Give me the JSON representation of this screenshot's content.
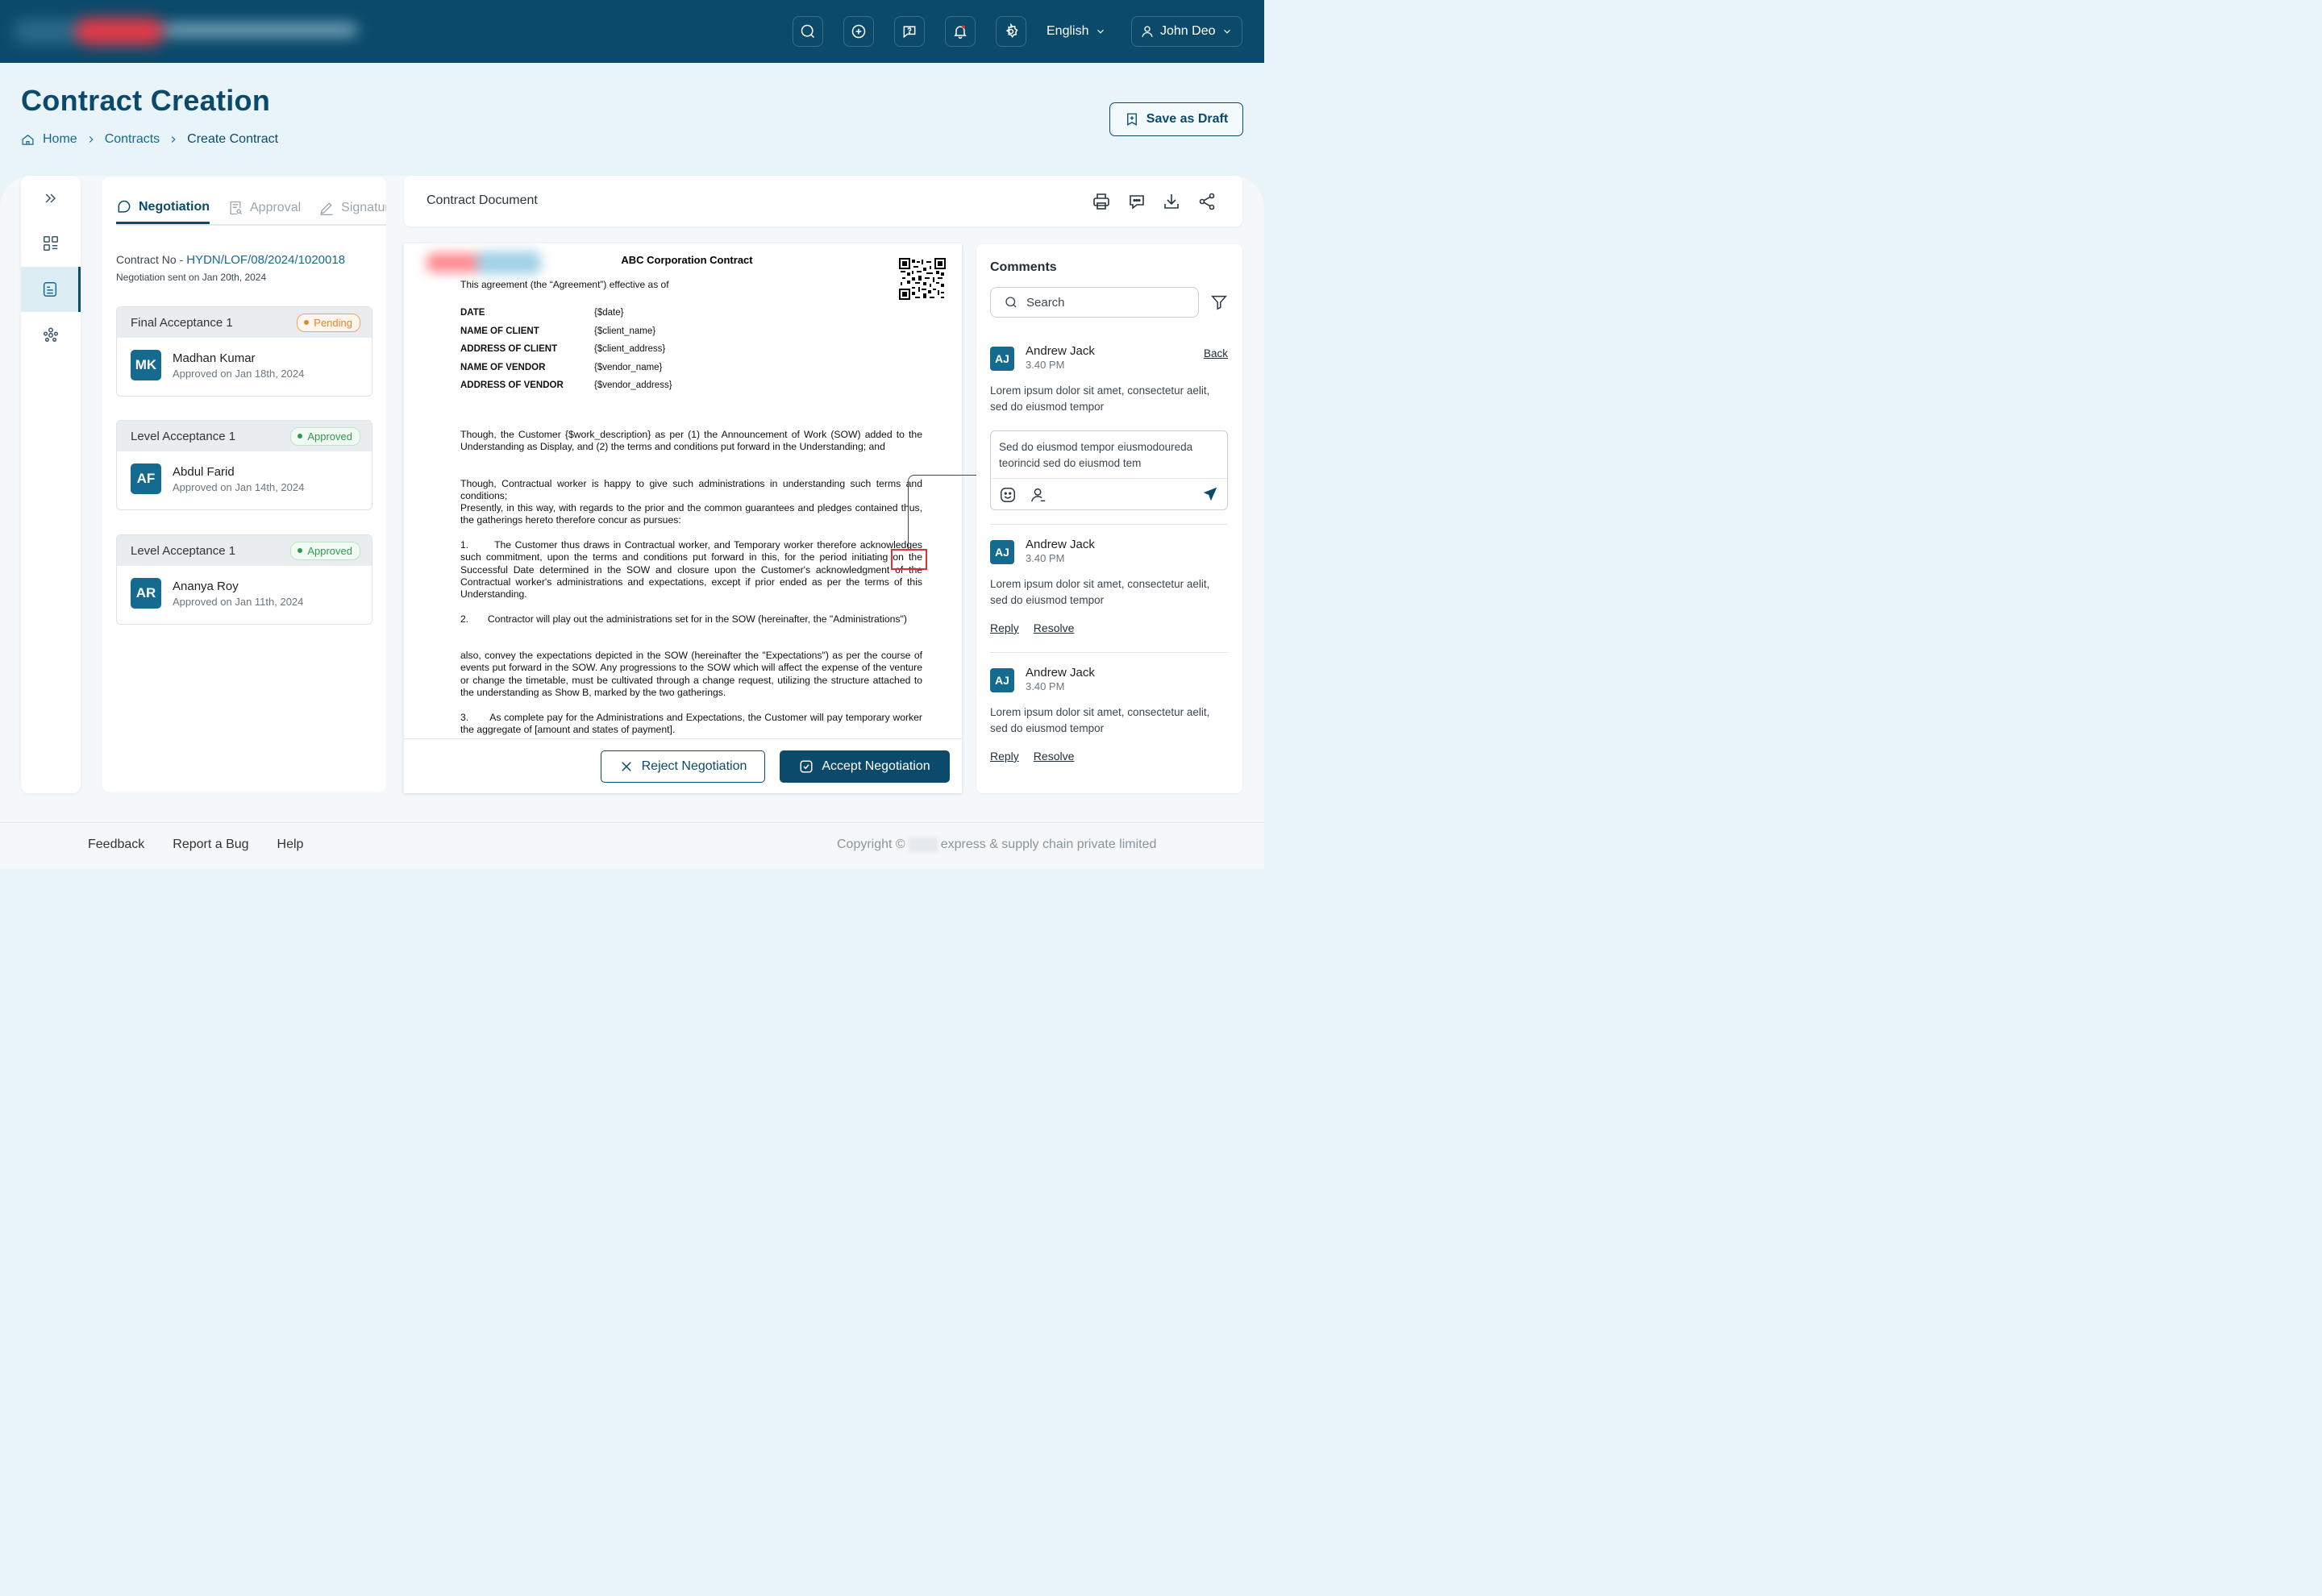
{
  "header": {
    "language": "English",
    "user_name": "John Deo",
    "icons": [
      "search-icon",
      "plus-circle-icon",
      "chat-question-icon",
      "bell-icon",
      "gear-icon"
    ]
  },
  "page": {
    "title": "Contract Creation",
    "breadcrumb": [
      "Home",
      "Contracts",
      "Create Contract"
    ],
    "save_draft": "Save as Draft"
  },
  "workflow": {
    "tabs": [
      "Negotiation",
      "Approval",
      "Signature"
    ],
    "contract_no_label": "Contract No -",
    "contract_no": "HYDN/LOF/08/2024/1020018",
    "sent_note": "Negotiation sent on Jan 20th, 2024",
    "acceptances": [
      {
        "title": "Final Acceptance 1",
        "status": "Pending",
        "initials": "MK",
        "name": "Madhan Kumar",
        "date": "Approved on Jan 18th, 2024"
      },
      {
        "title": "Level Acceptance 1",
        "status": "Approved",
        "initials": "AF",
        "name": "Abdul Farid",
        "date": "Approved on Jan 14th, 2024"
      },
      {
        "title": "Level Acceptance 1",
        "status": "Approved",
        "initials": "AR",
        "name": "Ananya Roy",
        "date": "Approved on Jan 11th, 2024"
      }
    ]
  },
  "document": {
    "panel_title": "Contract Document",
    "heading": "ABC Corporation Contract",
    "intro": "This agreement (the “Agreement”) effective as of",
    "fields": [
      {
        "key": "DATE",
        "value": "{$date}"
      },
      {
        "key": "NAME OF CLIENT",
        "value": "{$client_name}"
      },
      {
        "key": "ADDRESS OF CLIENT",
        "value": "{$client_address}"
      },
      {
        "key": "NAME OF VENDOR",
        "value": "{$vendor_name}"
      },
      {
        "key": "ADDRESS OF VENDOR",
        "value": "{$vendor_address}"
      }
    ],
    "para1": "Though, the Customer {$work_description} as per (1) the Announcement of Work (SOW) added to the Understanding as Display, and (2) the terms and conditions put forward in the Understanding; and",
    "para2": "Though, Contractual worker is happy to give such administrations in understanding such terms and conditions;",
    "para3": "Presently, in this way, with regards to the prior and the common guarantees and pledges contained thus, the gatherings hereto therefore concur as pursues:",
    "para4": "1.       The Customer thus draws in Contractual worker, and Temporary worker therefore acknowledges such commitment, upon the terms and conditions put forward in this, for the period initiating on the Successful Date determined in the SOW and closure upon the Customer's acknowledgment of the Contractual worker's administrations and expectations, except if prior ended as per the terms of this Understanding.",
    "para5": "2.       Contractor will play out the administrations set for in the SOW (hereinafter, the \"Administrations\")",
    "para6": "also, convey the expectations depicted in the SOW (hereinafter the \"Expectations\") as per the course of events put forward in the SOW. Any progressions to the SOW which will affect the expense of the venture or change the timetable, must be cultivated through a change request, utilizing the structure attached to the understanding as Show B, marked by the two gatherings.",
    "para7": "3.       As complete pay for the Administrations and Expectations, the Customer will pay temporary worker the aggregate of [amount and states of payment].",
    "reject": "Reject Negotiation",
    "accept": "Accept Negotiation"
  },
  "comments": {
    "title": "Comments",
    "search_placeholder": "Search",
    "back": "Back",
    "reply_draft": "Sed do eiusmod tempor eiusmodoureda teorincid sed do eiusmod tem",
    "items": [
      {
        "initials": "AJ",
        "name": "Andrew Jack",
        "time": "3.40 PM",
        "text": "Lorem ipsum dolor sit amet, consectetur aelit, sed do eiusmod tempor"
      },
      {
        "initials": "AJ",
        "name": "Andrew Jack",
        "time": "3.40 PM",
        "text": "Lorem ipsum dolor sit amet, consectetur aelit, sed do eiusmod tempor",
        "reply": "Reply",
        "resolve": "Resolve"
      },
      {
        "initials": "AJ",
        "name": "Andrew Jack",
        "time": "3.40 PM",
        "text": "Lorem ipsum dolor sit amet, consectetur aelit, sed do eiusmod tempor",
        "reply": "Reply",
        "resolve": "Resolve"
      }
    ]
  },
  "footer": {
    "links": [
      "Feedback",
      "Report a Bug",
      "Help"
    ],
    "copyright_prefix": "Copyright ©",
    "copyright_suffix": "express & supply chain private limited"
  },
  "colors": {
    "primary": "#0b4a6b",
    "accent": "#156a8f",
    "pending": "#e0842d",
    "approved": "#2e9a4a",
    "highlight": "#e0302f"
  }
}
